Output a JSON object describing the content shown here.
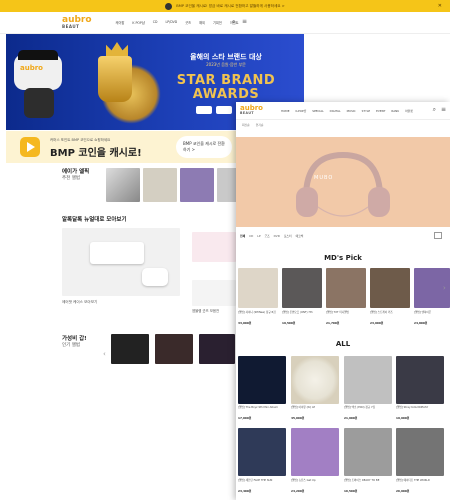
{
  "top_banner": {
    "text": "BMP 코인을 캐시로! 방금 바로 캐시로 전환하고 알뜰하게 사용하세요 >"
  },
  "logo": {
    "name": "aubro",
    "sub": "BEAUT"
  },
  "back_nav": [
    "케이팝",
    "K POP샵",
    "CD",
    "LP/DVD",
    "굿즈",
    "해외",
    "기획전",
    "이벤트"
  ],
  "hero": {
    "title": "올해의 스타 브랜드 대상",
    "subtitle": "2023년 음원·음반 부문",
    "brand_line1": "STAR BRAND",
    "brand_line2": "AWARDS"
  },
  "bmp": {
    "small": "커머스 포인트 BMP 코인으로 쇼핑하세요",
    "big": "BMP 코인을 캐시로!",
    "pill": "BMP 코인을 캐시로 전환하기 >"
  },
  "sections": {
    "s1_title": "에이가 엘픽",
    "s1_sub": "추천 앨범",
    "s2_title": "알록달록 뉴얼대로 모아보기",
    "s2_cap1": "에어팟 케이스 모아보기",
    "s2_cap2": "엠블렘 굿즈 모음전",
    "s3_title": "가성비 갑!",
    "s3_sub": "인기 앨범"
  },
  "front_nav": [
    "HOME",
    "K-POP샵",
    "SPECIAL",
    "DIGITAL",
    "MUSIC",
    "STYLE",
    "EVENT",
    "RANK",
    "아울렛"
  ],
  "front_sub": [
    "최신순",
    "인기순"
  ],
  "f_banner_brand": "MUBO",
  "sort_labels": [
    "전체",
    "CD",
    "LP",
    "굿즈",
    "DVD",
    "포스터",
    "에코백"
  ],
  "mds_pick": {
    "title": "MD's Pick",
    "items": [
      {
        "cap": "[앨범] 샤이니 (SHINee) 정규 8집",
        "price": "33,000원"
      },
      {
        "cap": "[앨범] 온앤오프 (ONF) 7th",
        "price": "19,500원"
      },
      {
        "cap": "[앨범] TXT 미니앨범",
        "price": "21,700원"
      },
      {
        "cap": "[앨범] 스트레이 키즈",
        "price": "23,900원"
      },
      {
        "cap": "[앨범] 엔하이픈",
        "price": "24,800원"
      }
    ]
  },
  "all": {
    "title": "ALL",
    "items": [
      {
        "cap": "[앨범] The Boyz 9th Mini Album",
        "price": "17,000원"
      },
      {
        "cap": "[앨범] 아이유 (IU) LP",
        "price": "45,000원"
      },
      {
        "cap": "[앨범] 엑소 (EXO) 정규 7집",
        "price": "21,900원"
      },
      {
        "cap": "[앨범] Stray Kids NOEASY",
        "price": "19,900원"
      },
      {
        "cap": "[앨범] 세븐틴 FACE THE SUN",
        "price": "23,400원"
      },
      {
        "cap": "[앨범] 뉴진스 Get Up",
        "price": "24,200원"
      },
      {
        "cap": "[앨범] 트와이스 READY TO BE",
        "price": "16,500원"
      },
      {
        "cap": "[앨범] 에이티즈 THE WORLD",
        "price": "26,900원"
      }
    ]
  },
  "colors": {
    "accent": "#f0a81a",
    "banner": "#f5c518",
    "hero": "#1c3fb6",
    "front_banner": "#f2c9a8"
  }
}
